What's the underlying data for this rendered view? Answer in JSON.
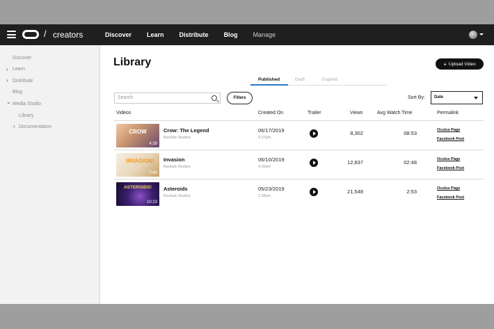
{
  "nav": {
    "brand": "creators",
    "slash": "/",
    "links": [
      "Discover",
      "Learn",
      "Distribute",
      "Blog",
      "Manage"
    ]
  },
  "sidebar": {
    "items": [
      {
        "label": "Discover",
        "caret": ""
      },
      {
        "label": "Learn",
        "caret": "›"
      },
      {
        "label": "Distribute",
        "caret": "›"
      },
      {
        "label": "Blog",
        "caret": ""
      },
      {
        "label": "Media Studio",
        "caret": "⌄"
      },
      {
        "label": "Library",
        "caret": ""
      },
      {
        "label": "Documentation",
        "caret": "›"
      }
    ]
  },
  "main": {
    "title": "Library",
    "upload_label": "Upload Video",
    "upload_plus": "+",
    "tabs": [
      "Published",
      "Draft",
      "Expired"
    ],
    "search_placeholder": "Search",
    "filters_label": "Filters",
    "sort_label": "Sort By:",
    "sort_value": "Date",
    "columns": [
      "Videos",
      "Created On",
      "Trailer",
      "Views",
      "Avg Watch Time",
      "Permalink"
    ]
  },
  "videos": [
    {
      "thumb_text": "CROW",
      "duration": "4:39",
      "title": "Crow: The Legend",
      "studio": "Baobab Studios",
      "date": "06/17/2019",
      "time": "6:37pm",
      "views": "8,302",
      "watch": "08:53",
      "link1": "Oculus Page",
      "link2": "Facebook Post"
    },
    {
      "thumb_text": "INVASION!",
      "duration": "7:40",
      "title": "Invasion",
      "studio": "Baobab Studios",
      "date": "06/10/2019",
      "time": "4:30pm",
      "views": "12,837",
      "watch": "02:48",
      "link1": "Oculus Page",
      "link2": "Facebook Post"
    },
    {
      "thumb_text": "ASTEROIDS!",
      "duration": "10:23",
      "title": "Asteroids",
      "studio": "Baobab Studios",
      "date": "05/23/2019",
      "time": "2:38pm",
      "views": "21,548",
      "watch": "2:53",
      "link1": "Oculus Page",
      "link2": "Facebook Post"
    }
  ]
}
